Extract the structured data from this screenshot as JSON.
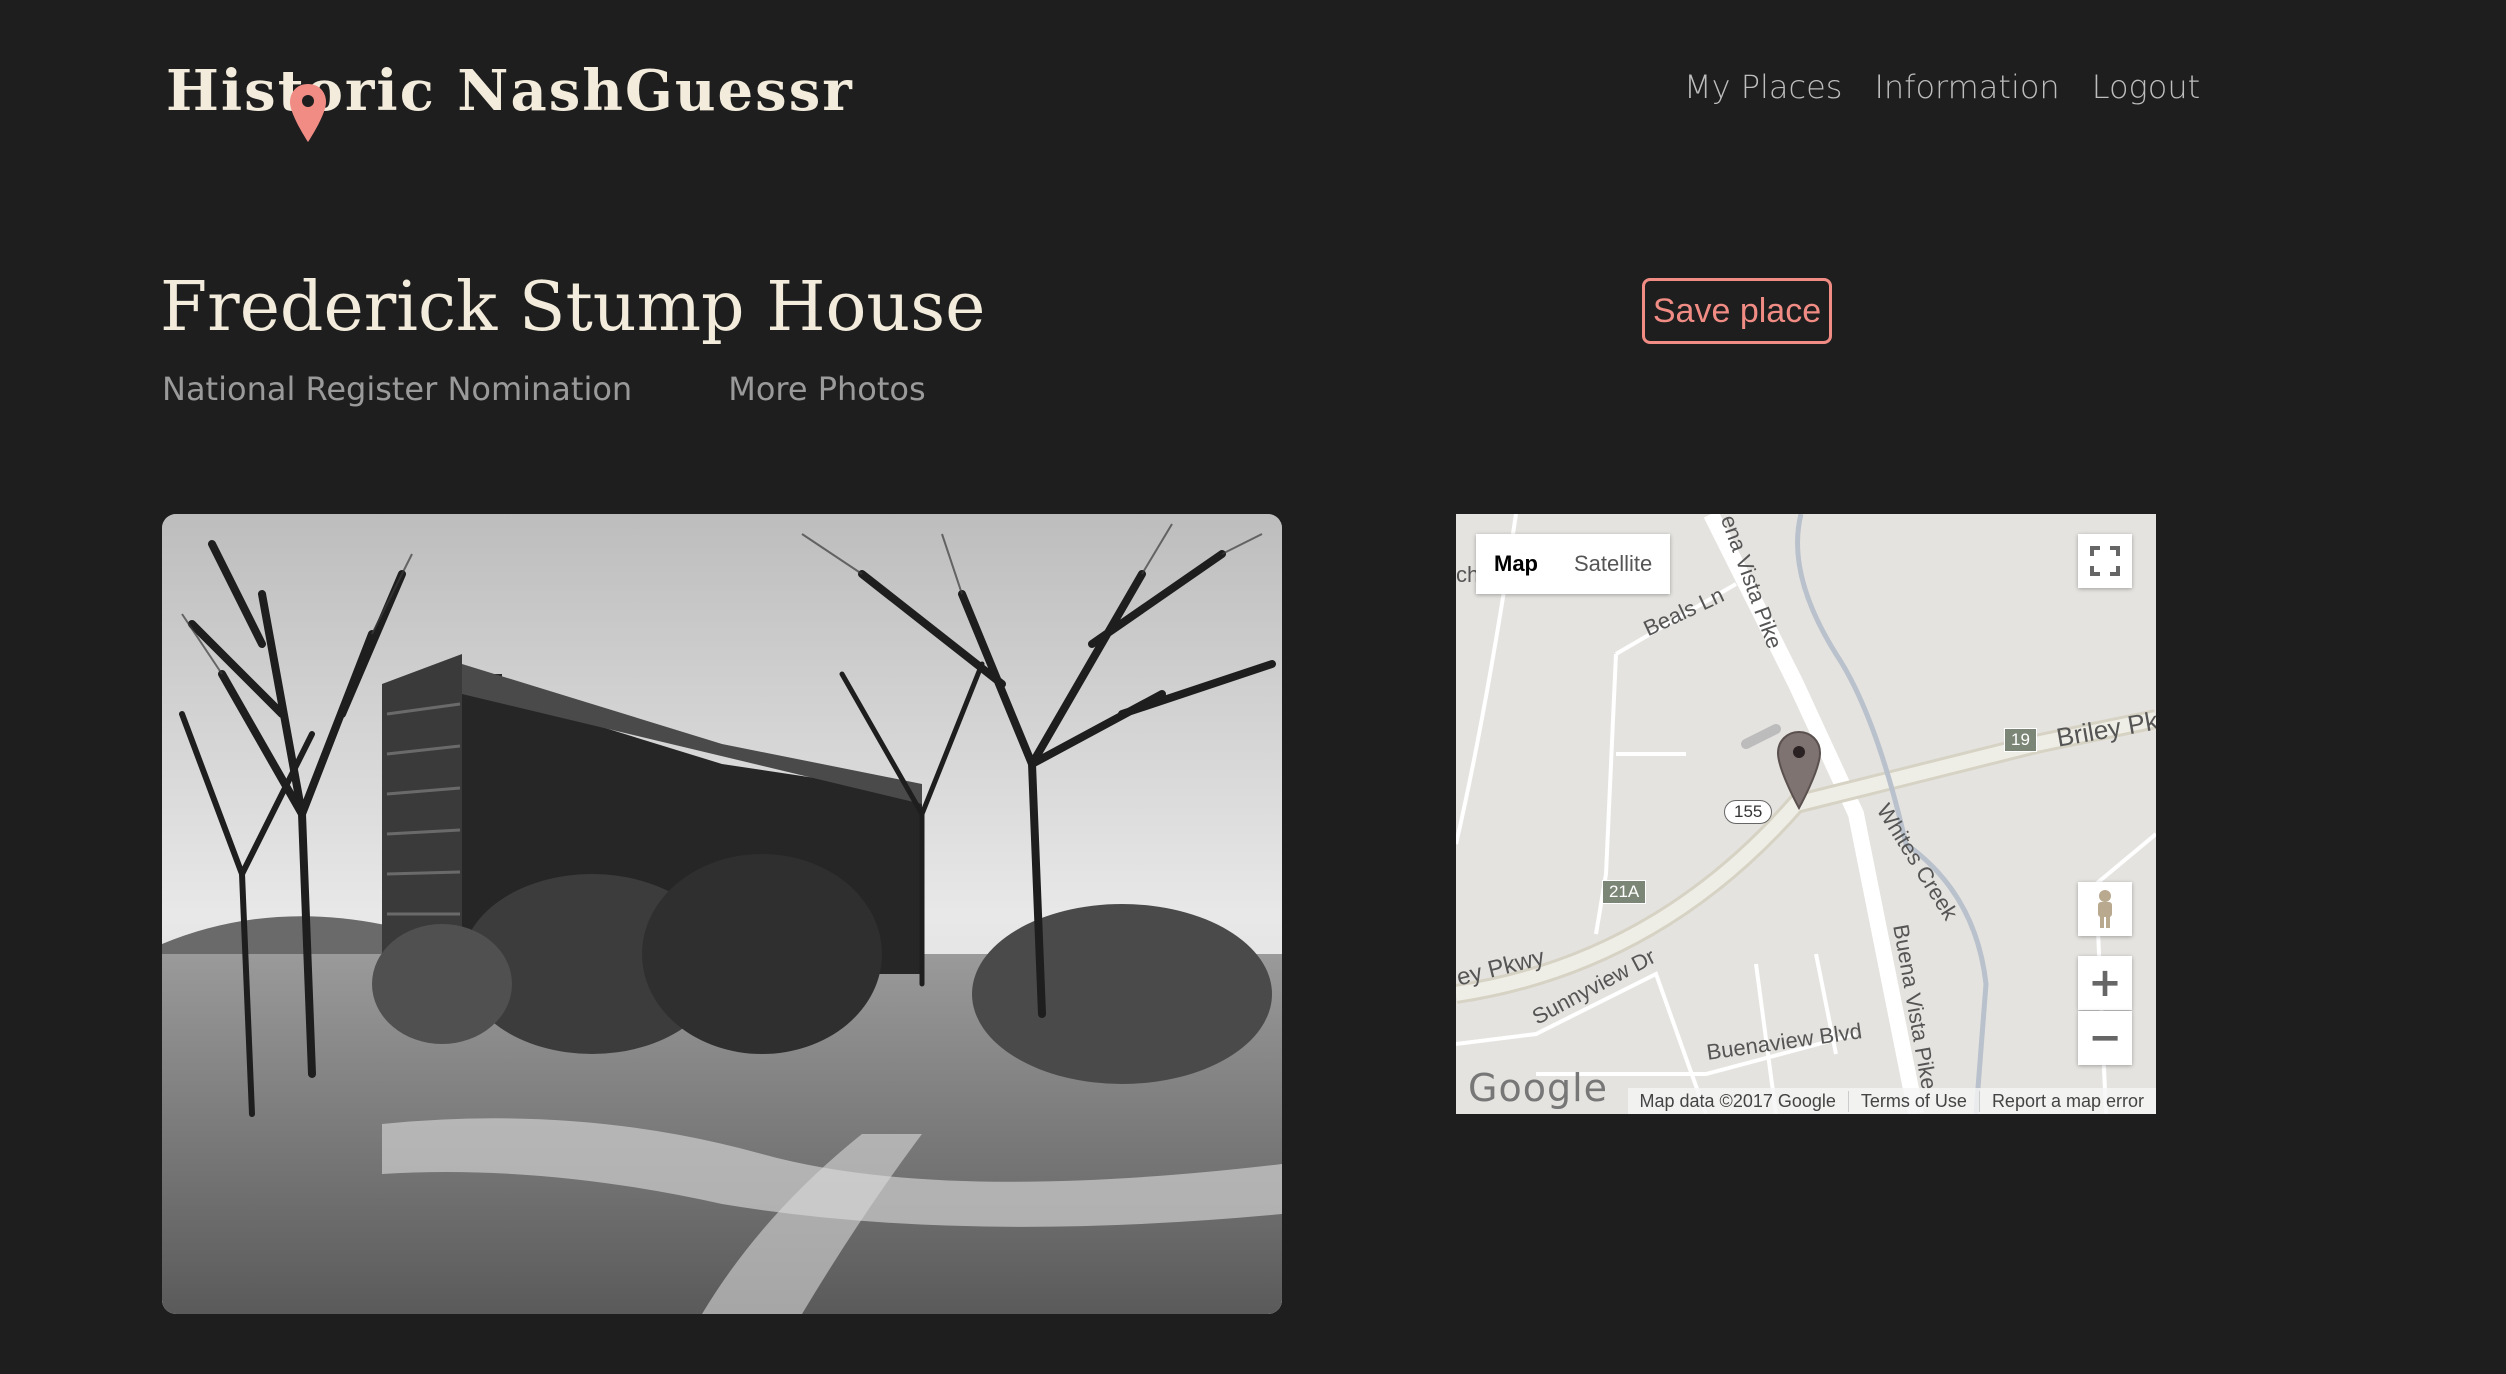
{
  "header": {
    "logo_text": "Historic NashGuessr",
    "nav": [
      "My Places",
      "Information",
      "Logout"
    ]
  },
  "place": {
    "title": "Frederick Stump House",
    "links": [
      "National Register Nomination",
      "More Photos"
    ],
    "save_label": "Save place"
  },
  "map": {
    "type_buttons": [
      "Map",
      "Satellite"
    ],
    "roads": [
      "Buena Vista Pike",
      "Briley Pk",
      "Beals Ln",
      "Whites Creek",
      "Sunnyview Dr",
      "Buenaview Blvd",
      "ey Pkwy",
      "ena Vista Pike",
      "ch"
    ],
    "shields": [
      "19",
      "21A",
      "155"
    ],
    "logo": "Google",
    "footer": [
      "Map data ©2017 Google",
      "Terms of Use",
      "Report a map error"
    ],
    "zoom_in": "+",
    "zoom_out": "−"
  },
  "colors": {
    "background": "#1e1e1e",
    "accent": "#f08c84",
    "title": "#f3ecdc"
  }
}
